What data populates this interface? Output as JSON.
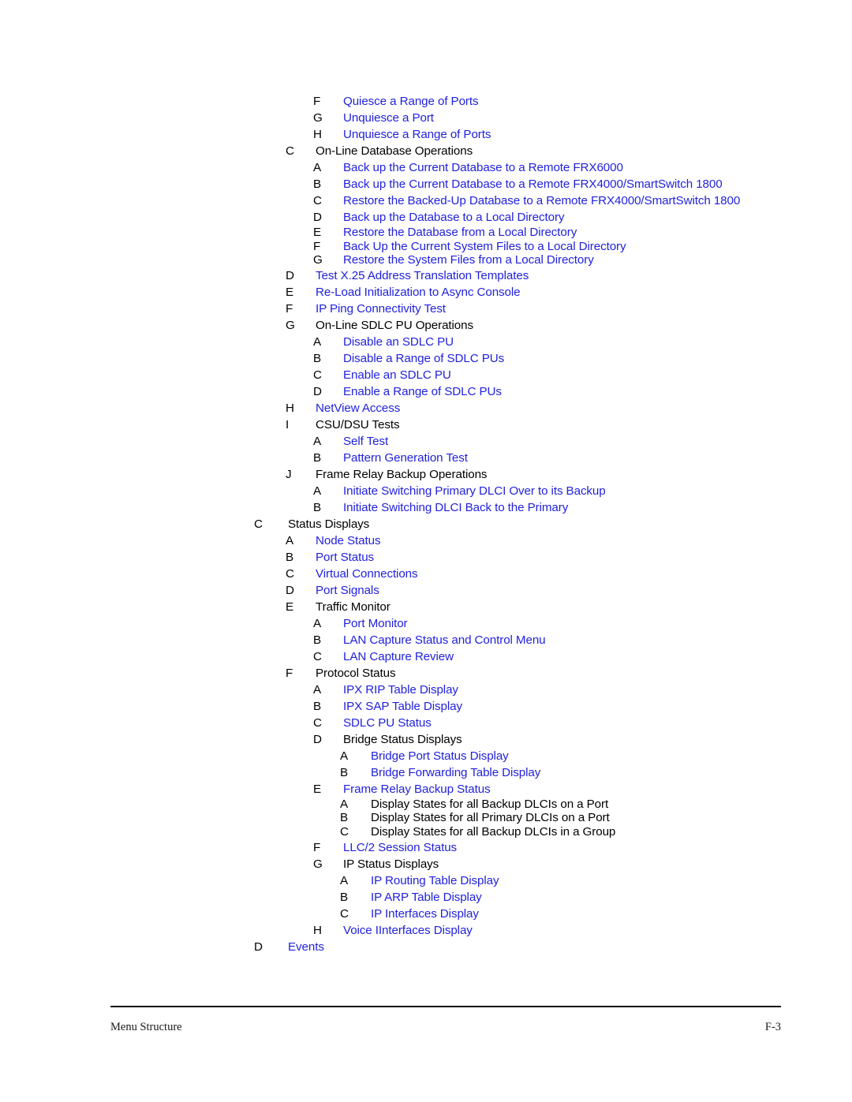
{
  "page": {
    "footer_left": "Menu Structure",
    "footer_right": "F-3",
    "link_color": "#2222dd",
    "text_color": "#000000"
  },
  "toc": {
    "entries": [
      {
        "level": 3,
        "marker": "F",
        "label": "Quiesce a Range of Ports",
        "link": true,
        "tight": false
      },
      {
        "level": 3,
        "marker": "G",
        "label": "Unquiesce a Port",
        "link": true,
        "tight": false
      },
      {
        "level": 3,
        "marker": "H",
        "label": "Unquiesce a Range of Ports",
        "link": true,
        "tight": false
      },
      {
        "level": 2,
        "marker": "C",
        "label": "On-Line Database Operations",
        "link": false,
        "tight": false
      },
      {
        "level": 3,
        "marker": "A",
        "label": "Back up the Current Database to a Remote FRX6000",
        "link": true,
        "tight": false
      },
      {
        "level": 3,
        "marker": "B",
        "label": "Back up the Current Database to a Remote FRX4000/SmartSwitch 1800",
        "link": true,
        "tight": false
      },
      {
        "level": 3,
        "marker": "C",
        "label": "Restore the Backed-Up Database to a Remote FRX4000/SmartSwitch 1800",
        "link": true,
        "tight": false
      },
      {
        "level": 3,
        "marker": "D",
        "label": "Back up the Database to a Local Directory",
        "link": true,
        "tight": false
      },
      {
        "level": 3,
        "marker": "E",
        "label": "Restore the Database from a Local Directory",
        "link": true,
        "tight": true
      },
      {
        "level": 3,
        "marker": "F",
        "label": "Back Up the Current System Files to a Local Directory",
        "link": true,
        "tight": true
      },
      {
        "level": 3,
        "marker": "G",
        "label": "Restore the System Files from a Local Directory",
        "link": true,
        "tight": true
      },
      {
        "level": 2,
        "marker": "D",
        "label": "Test X.25 Address Translation Templates",
        "link": true,
        "tight": false
      },
      {
        "level": 2,
        "marker": "E",
        "label": "Re-Load Initialization to Async Console",
        "link": true,
        "tight": false
      },
      {
        "level": 2,
        "marker": "F",
        "label": "IP Ping Connectivity Test",
        "link": true,
        "tight": false
      },
      {
        "level": 2,
        "marker": "G",
        "label": "On-Line SDLC PU Operations",
        "link": false,
        "tight": false
      },
      {
        "level": 3,
        "marker": "A",
        "label": "Disable an SDLC PU",
        "link": true,
        "tight": false
      },
      {
        "level": 3,
        "marker": "B",
        "label": "Disable a Range of SDLC PUs",
        "link": true,
        "tight": false
      },
      {
        "level": 3,
        "marker": "C",
        "label": "Enable an SDLC PU",
        "link": true,
        "tight": false
      },
      {
        "level": 3,
        "marker": "D",
        "label": "Enable a Range of SDLC PUs",
        "link": true,
        "tight": false
      },
      {
        "level": 2,
        "marker": "H",
        "label": "NetView Access",
        "link": true,
        "tight": false
      },
      {
        "level": 2,
        "marker": "I",
        "label": "CSU/DSU Tests",
        "link": false,
        "tight": false
      },
      {
        "level": 3,
        "marker": "A",
        "label": "Self Test",
        "link": true,
        "tight": false
      },
      {
        "level": 3,
        "marker": "B",
        "label": "Pattern Generation Test",
        "link": true,
        "tight": false
      },
      {
        "level": 2,
        "marker": "J",
        "label": "Frame Relay Backup Operations",
        "link": false,
        "tight": false
      },
      {
        "level": 3,
        "marker": "A",
        "label": "Initiate Switching Primary DLCI Over to its Backup",
        "link": true,
        "tight": false
      },
      {
        "level": 3,
        "marker": "B",
        "label": "Initiate Switching DLCI Back to the Primary",
        "link": true,
        "tight": false
      },
      {
        "level": 1,
        "marker": "C",
        "label": "Status Displays",
        "link": false,
        "tight": false
      },
      {
        "level": 2,
        "marker": "A",
        "label": "Node Status",
        "link": true,
        "tight": false
      },
      {
        "level": 2,
        "marker": "B",
        "label": "Port Status",
        "link": true,
        "tight": false
      },
      {
        "level": 2,
        "marker": "C",
        "label": "Virtual Connections",
        "link": true,
        "tight": false
      },
      {
        "level": 2,
        "marker": "D",
        "label": "Port Signals",
        "link": true,
        "tight": false
      },
      {
        "level": 2,
        "marker": "E",
        "label": "Traffic Monitor",
        "link": false,
        "tight": false
      },
      {
        "level": 3,
        "marker": "A",
        "label": "Port Monitor",
        "link": true,
        "tight": false
      },
      {
        "level": 3,
        "marker": "B",
        "label": "LAN Capture Status and Control Menu",
        "link": true,
        "tight": false
      },
      {
        "level": 3,
        "marker": "C",
        "label": "LAN Capture Review",
        "link": true,
        "tight": false
      },
      {
        "level": 2,
        "marker": "F",
        "label": "Protocol Status",
        "link": false,
        "tight": false
      },
      {
        "level": 3,
        "marker": "A",
        "label": "IPX RIP Table Display",
        "link": true,
        "tight": false
      },
      {
        "level": 3,
        "marker": "B",
        "label": "IPX SAP Table Display",
        "link": true,
        "tight": false
      },
      {
        "level": 3,
        "marker": "C",
        "label": "SDLC PU Status",
        "link": true,
        "tight": false
      },
      {
        "level": 3,
        "marker": "D",
        "label": "Bridge Status Displays",
        "link": false,
        "tight": false
      },
      {
        "level": 4,
        "marker": "A",
        "label": "Bridge Port Status Display",
        "link": true,
        "tight": false
      },
      {
        "level": 4,
        "marker": "B",
        "label": "Bridge Forwarding Table Display",
        "link": true,
        "tight": false
      },
      {
        "level": 3,
        "marker": "E",
        "label": "Frame Relay Backup Status",
        "link": true,
        "tight": false
      },
      {
        "level": 4,
        "marker": "A",
        "label": "Display States for all Backup DLCIs on a Port",
        "link": false,
        "tight": true
      },
      {
        "level": 4,
        "marker": "B",
        "label": "Display States for all Primary DLCIs on a Port",
        "link": false,
        "tight": true
      },
      {
        "level": 4,
        "marker": "C",
        "label": "Display States for all Backup DLCIs in a Group",
        "link": false,
        "tight": true
      },
      {
        "level": 3,
        "marker": "F",
        "label": "LLC/2 Session Status",
        "link": true,
        "tight": false
      },
      {
        "level": 3,
        "marker": "G",
        "label": "IP Status Displays",
        "link": false,
        "tight": false
      },
      {
        "level": 4,
        "marker": "A",
        "label": "IP Routing Table Display",
        "link": true,
        "tight": false
      },
      {
        "level": 4,
        "marker": "B",
        "label": "IP ARP Table Display",
        "link": true,
        "tight": false
      },
      {
        "level": 4,
        "marker": "C",
        "label": "IP Interfaces Display",
        "link": true,
        "tight": false
      },
      {
        "level": 3,
        "marker": "H",
        "label": "Voice IInterfaces Display",
        "link": true,
        "tight": false
      },
      {
        "level": 1,
        "marker": "D",
        "label": "Events",
        "link": true,
        "tight": false
      }
    ]
  }
}
